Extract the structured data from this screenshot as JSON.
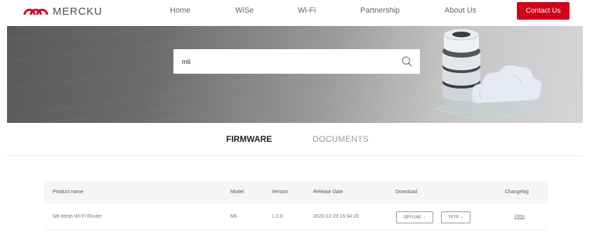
{
  "brand": {
    "name": "MERCKU",
    "accent": "#d0021b"
  },
  "nav": {
    "items": [
      {
        "label": "Home"
      },
      {
        "label": "WiSe"
      },
      {
        "label": "Wi-Fi"
      },
      {
        "label": "Partnership"
      },
      {
        "label": "About Us"
      }
    ],
    "contact_label": "Contact Us"
  },
  "search": {
    "value": "m6",
    "icon": "search-icon"
  },
  "tabs": [
    {
      "label": "FIRMWARE",
      "active": true
    },
    {
      "label": "DOCUMENTS",
      "active": false
    }
  ],
  "table": {
    "headers": {
      "product": "Product name",
      "model": "Model",
      "version": "Version",
      "date": "Release Date",
      "download": "Download",
      "changelog": "Changelog"
    },
    "rows": [
      {
        "product": "M6 Mesh Wi-Fi Router",
        "model": "M6",
        "version": "1.0.0",
        "date": "2020-12-29 15:54:28",
        "download_offline": "OFFLINE",
        "download_tftp": "TFTP",
        "changelog": "View"
      }
    ]
  }
}
